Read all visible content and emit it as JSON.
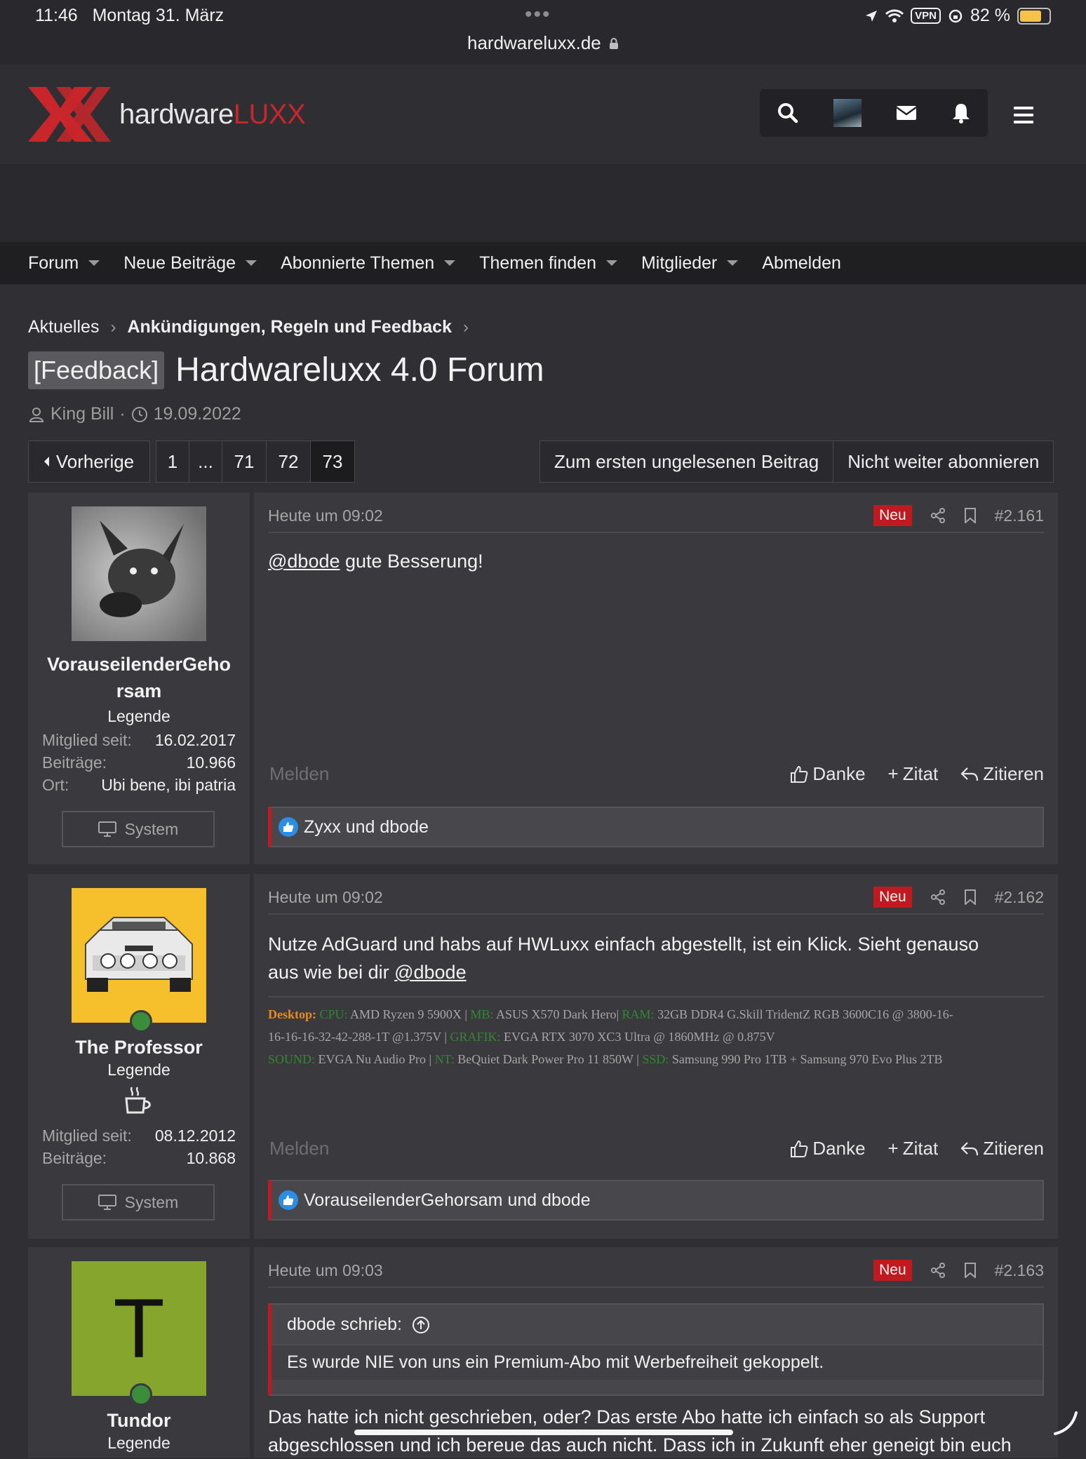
{
  "status_bar": {
    "time": "11:46",
    "date": "Montag 31. März",
    "url": "hardwareluxx.de",
    "vpn": "VPN",
    "battery": "82 %",
    "battery_level": 0.82
  },
  "header": {
    "logo_text_a": "hardware",
    "logo_text_b": "LUXX",
    "brand_red": "#c8262b"
  },
  "nav": {
    "items": [
      {
        "label": "Forum",
        "dropdown": true
      },
      {
        "label": "Neue Beiträge",
        "dropdown": true
      },
      {
        "label": "Abonnierte Themen",
        "dropdown": true
      },
      {
        "label": "Themen finden",
        "dropdown": true
      },
      {
        "label": "Mitglieder",
        "dropdown": true
      },
      {
        "label": "Abmelden",
        "dropdown": false
      }
    ]
  },
  "breadcrumb": {
    "home": "Aktuelles",
    "section": "Ankündigungen, Regeln und Feedback"
  },
  "thread": {
    "prefix": "[Feedback]",
    "title": "Hardwareluxx 4.0 Forum",
    "author": "King Bill",
    "separator": "·",
    "date": "19.09.2022"
  },
  "pagination": {
    "prev_label": "Vorherige",
    "pages": [
      "1",
      "...",
      "71",
      "72",
      "73"
    ],
    "current": "73"
  },
  "thread_actions": {
    "first_unread": "Zum ersten ungelesenen Beitrag",
    "unwatch": "Nicht weiter abonnieren"
  },
  "labels": {
    "joined": "Mitglied seit:",
    "posts": "Beiträge:",
    "location": "Ort:",
    "system": "System",
    "new_badge": "Neu",
    "report": "Melden",
    "thanks": "Danke",
    "quote_add": "Zitat",
    "reply_quote": "Zitieren"
  },
  "posts": [
    {
      "username_line1": "VorauseilenderGeho",
      "username_line2": "rsam",
      "user_title": "Legende",
      "joined": "16.02.2017",
      "post_count": "10.966",
      "location": "Ubi bene, ibi patria",
      "time": "Heute um 09:02",
      "number": "#2.161",
      "mention": "@dbode",
      "text": " gute Besserung!",
      "reactions": "Zyxx und dbode"
    },
    {
      "username": "The Professor",
      "user_title": "Legende",
      "joined": "08.12.2012",
      "post_count": "10.868",
      "time": "Heute um 09:02",
      "number": "#2.162",
      "text_line1": "Nutze AdGuard und habs auf HWLuxx einfach abgestellt, ist ein Klick. Sieht genauso",
      "text_line2": "aus wie bei dir ",
      "mention": "@dbode",
      "signature": {
        "desktop": "Desktop:",
        "cpu_k": "CPU:",
        "cpu_v": " AMD Ryzen 9 5900X | ",
        "mb_k": "MB:",
        "mb_v": " ASUS X570 Dark Hero| ",
        "ram_k": "RAM:",
        "ram_v": " 32GB DDR4 G.Skill TridentZ RGB 3600C16 @ 3800-16-",
        "ram_v2": "16-16-16-32-42-288-1T @1.375V | ",
        "gpu_k": "GRAFIK:",
        "gpu_v": " EVGA RTX 3070 XC3 Ultra @ 1860MHz @ 0.875V",
        "sound_k": "SOUND:",
        "sound_v": " EVGA Nu Audio Pro | ",
        "nt_k": "NT:",
        "nt_v": " BeQuiet Dark Power Pro 11 850W | ",
        "ssd_k": "SSD:",
        "ssd_v": " Samsung 990 Pro 1TB + Samsung 970 Evo Plus 2TB"
      },
      "reactions": "VorauseilenderGehorsam und dbode"
    },
    {
      "username": "Tundor",
      "avatar_letter": "T",
      "user_title": "Legende",
      "time": "Heute um 09:03",
      "number": "#2.163",
      "quote_author": "dbode schrieb:",
      "quote_text": "Es wurde NIE von uns ein Premium-Abo mit Werbefreiheit gekoppelt.",
      "text_line1": "Das hatte ich nicht geschrieben, oder? Das erste Abo hatte ich einfach so als Support",
      "text_line2": "abgeschlossen und ich bereue das auch nicht. Dass ich in Zukunft eher geneigt bin euch"
    }
  ]
}
